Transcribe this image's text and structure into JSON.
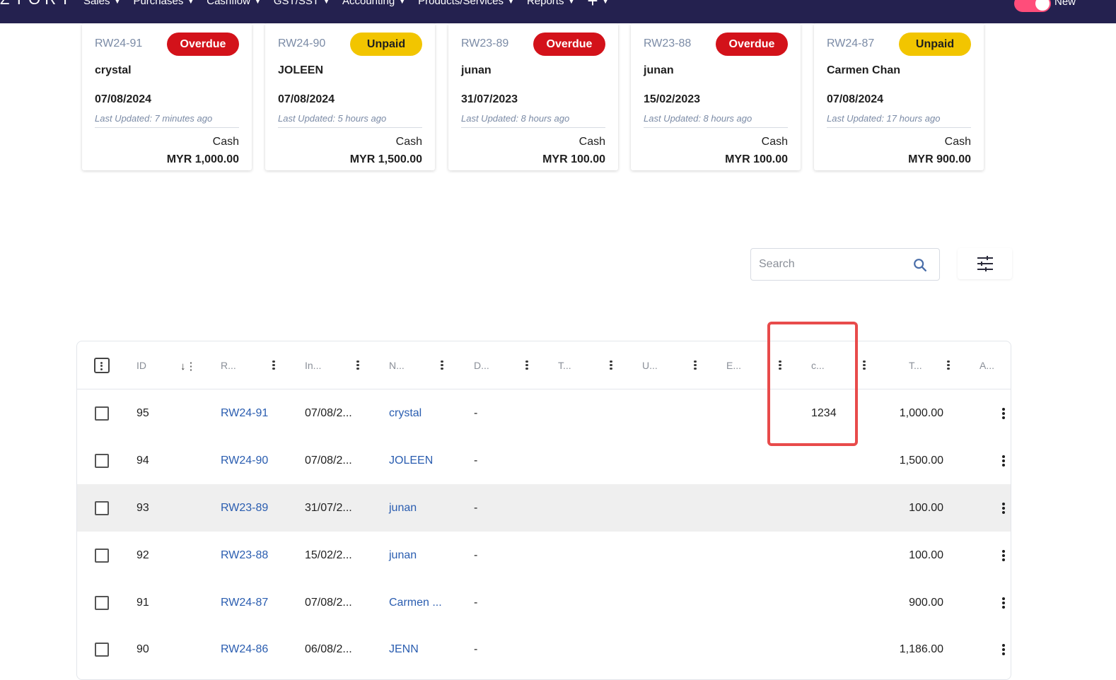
{
  "nav": {
    "brand": "ZYORY",
    "items": [
      "Sales",
      "Purchases",
      "Cashflow",
      "GST/SST",
      "Accounting",
      "Products/Services",
      "Reports"
    ],
    "toggle_label": "New"
  },
  "cards": [
    {
      "no": "RW24-91",
      "status": "Overdue",
      "name": "crystal",
      "date": "07/08/2024",
      "updated": "Last Updated: 7 minutes ago",
      "method": "Cash",
      "amount": "MYR 1,000.00"
    },
    {
      "no": "RW24-90",
      "status": "Unpaid",
      "name": "JOLEEN",
      "date": "07/08/2024",
      "updated": "Last Updated: 5 hours ago",
      "method": "Cash",
      "amount": "MYR 1,500.00"
    },
    {
      "no": "RW23-89",
      "status": "Overdue",
      "name": "junan",
      "date": "31/07/2023",
      "updated": "Last Updated: 8 hours ago",
      "method": "Cash",
      "amount": "MYR 100.00"
    },
    {
      "no": "RW23-88",
      "status": "Overdue",
      "name": "junan",
      "date": "15/02/2023",
      "updated": "Last Updated: 8 hours ago",
      "method": "Cash",
      "amount": "MYR 100.00"
    },
    {
      "no": "RW24-87",
      "status": "Unpaid",
      "name": "Carmen Chan",
      "date": "07/08/2024",
      "updated": "Last Updated: 17 hours ago",
      "method": "Cash",
      "amount": "MYR 900.00"
    }
  ],
  "search": {
    "placeholder": "Search"
  },
  "table": {
    "headers": {
      "id": "ID",
      "ref": "R...",
      "invoice_date": "In...",
      "name": "N...",
      "desc": "D...",
      "t1": "T...",
      "u": "U...",
      "e": "E...",
      "custom": "c...",
      "total": "T...",
      "actions": "A..."
    },
    "rows": [
      {
        "id": "95",
        "ref": "RW24-91",
        "date": "07/08/2...",
        "name": "crystal",
        "desc": "-",
        "custom": "1234",
        "total": "1,000.00"
      },
      {
        "id": "94",
        "ref": "RW24-90",
        "date": "07/08/2...",
        "name": "JOLEEN",
        "desc": "-",
        "custom": "",
        "total": "1,500.00"
      },
      {
        "id": "93",
        "ref": "RW23-89",
        "date": "31/07/2...",
        "name": "junan",
        "desc": "-",
        "custom": "",
        "total": "100.00"
      },
      {
        "id": "92",
        "ref": "RW23-88",
        "date": "15/02/2...",
        "name": "junan",
        "desc": "-",
        "custom": "",
        "total": "100.00"
      },
      {
        "id": "91",
        "ref": "RW24-87",
        "date": "07/08/2...",
        "name": "Carmen ...",
        "desc": "-",
        "custom": "",
        "total": "900.00"
      },
      {
        "id": "90",
        "ref": "RW24-86",
        "date": "06/08/2...",
        "name": "JENN",
        "desc": "-",
        "custom": "",
        "total": "1,186.00"
      }
    ]
  },
  "colors": {
    "navbar": "#24214f",
    "overdue": "#d3121a",
    "unpaid": "#f2c500",
    "link": "#2a5db0",
    "highlight": "#e84b4b"
  }
}
